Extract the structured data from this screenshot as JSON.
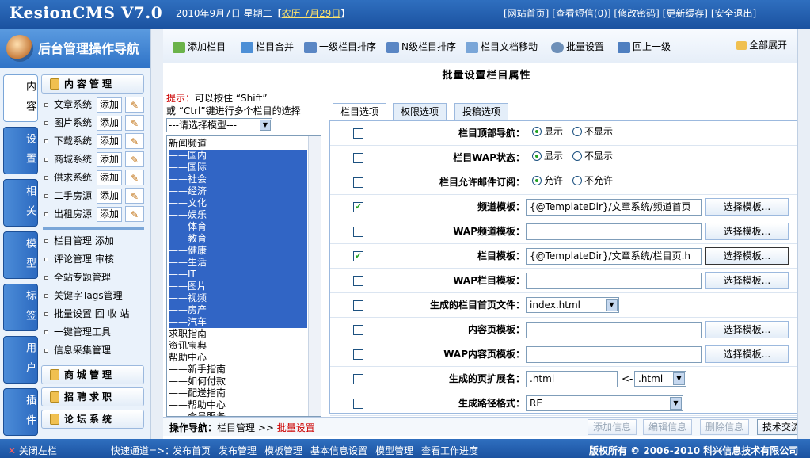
{
  "header": {
    "logo": "KesionCMS V7.0",
    "date": "2010年9月7日 星期二【",
    "lunar": "农历 7月29日",
    "date_end": "】",
    "links": [
      "[网站首页]",
      "[查看短信(0)]",
      "[修改密码]",
      "[更新缓存]",
      "[安全退出]"
    ]
  },
  "leftnav": {
    "title": "后台管理操作导航",
    "vtabs": [
      "内容",
      "设置",
      "相关",
      "模型",
      "标签",
      "用户",
      "插件"
    ],
    "content_header": "内容管理",
    "systems": [
      {
        "label": "文章系统",
        "add": "添加"
      },
      {
        "label": "图片系统",
        "add": "添加"
      },
      {
        "label": "下载系统",
        "add": "添加"
      },
      {
        "label": "商城系统",
        "add": "添加"
      },
      {
        "label": "供求系统",
        "add": "添加"
      },
      {
        "label": "二手房源",
        "add": "添加"
      },
      {
        "label": "出租房源",
        "add": "添加"
      }
    ],
    "menu": [
      "栏目管理 添加",
      "评论管理 审核",
      "全站专题管理",
      "关键字Tags管理",
      "批量设置 回 收 站",
      "一键管理工具",
      "信息采集管理"
    ],
    "panels": [
      "商城管理",
      "招聘求职",
      "论坛系统"
    ]
  },
  "toolbar": [
    "添加栏目",
    "栏目合并",
    "一级栏目排序",
    "N级栏目排序",
    "栏目文档移动",
    "批量设置",
    "回上一级"
  ],
  "expand_all": "全部展开",
  "page_title": "批量设置栏目属性",
  "hint": {
    "prefix": "提示：",
    "line1": "可以按住 “Shift”",
    "line2": "或 “Ctrl”键进行多个栏目的选择"
  },
  "model_select": "---请选择模型---",
  "categories": [
    {
      "label": "新闻频道",
      "sel": false
    },
    {
      "label": "——国内",
      "sel": true
    },
    {
      "label": "——国际",
      "sel": true
    },
    {
      "label": "——社会",
      "sel": true
    },
    {
      "label": "——经济",
      "sel": true
    },
    {
      "label": "——文化",
      "sel": true
    },
    {
      "label": "——娱乐",
      "sel": true
    },
    {
      "label": "——体育",
      "sel": true
    },
    {
      "label": "——教育",
      "sel": true
    },
    {
      "label": "——健康",
      "sel": true
    },
    {
      "label": "——生活",
      "sel": true
    },
    {
      "label": "——IT",
      "sel": true
    },
    {
      "label": "——图片",
      "sel": true
    },
    {
      "label": "——视频",
      "sel": true
    },
    {
      "label": "——房产",
      "sel": true
    },
    {
      "label": "——汽车",
      "sel": true
    },
    {
      "label": "求职指南",
      "sel": false
    },
    {
      "label": "资讯宝典",
      "sel": false
    },
    {
      "label": "帮助中心",
      "sel": false
    },
    {
      "label": "——新手指南",
      "sel": false
    },
    {
      "label": "——如何付款",
      "sel": false
    },
    {
      "label": "——配送指南",
      "sel": false
    },
    {
      "label": "——帮助中心",
      "sel": false
    },
    {
      "label": "——会员服务",
      "sel": false
    }
  ],
  "tabs": [
    "栏目选项",
    "权限选项",
    "投稿选项"
  ],
  "form": [
    {
      "label": "栏目顶部导航：",
      "type": "radio",
      "checked": false,
      "options": [
        "显示",
        "不显示"
      ]
    },
    {
      "label": "栏目WAP状态：",
      "type": "radio",
      "checked": false,
      "options": [
        "显示",
        "不显示"
      ]
    },
    {
      "label": "栏目允许邮件订阅：",
      "type": "radio",
      "checked": false,
      "options": [
        "允许",
        "不允许"
      ]
    },
    {
      "label": "频道模板：",
      "type": "tpl",
      "checked": true,
      "value": "{@TemplateDir}/文章系统/频道首页",
      "btn": "选择模板..."
    },
    {
      "label": "WAP频道模板：",
      "type": "tpl",
      "checked": false,
      "value": "",
      "btn": "选择模板..."
    },
    {
      "label": "栏目模板：",
      "type": "tpl",
      "checked": true,
      "value": "{@TemplateDir}/文章系统/栏目页.h",
      "btn": "选择模板..."
    },
    {
      "label": "WAP栏目模板：",
      "type": "tpl",
      "checked": false,
      "value": "",
      "btn": "选择模板..."
    },
    {
      "label": "生成的栏目首页文件：",
      "type": "select",
      "checked": false,
      "value": "index.html"
    },
    {
      "label": "内容页模板：",
      "type": "tpl",
      "checked": false,
      "value": "",
      "btn": "选择模板..."
    },
    {
      "label": "WAP内容页模板：",
      "type": "tpl",
      "checked": false,
      "value": "",
      "btn": "选择模板..."
    },
    {
      "label": "生成的页扩展名：",
      "type": "ext",
      "checked": false,
      "value": ".html",
      "arrow": "<-",
      "select": ".html"
    },
    {
      "label": "生成路径格式：",
      "type": "select_wide",
      "checked": false,
      "value": "RE"
    }
  ],
  "footer": {
    "nav_label": "操作导航：",
    "crumb1": "栏目管理",
    "sep": ">>",
    "crumb2": "批量设置",
    "buttons": [
      "添加信息",
      "编辑信息",
      "删除信息",
      "技术交流"
    ]
  },
  "statusbar": {
    "close": "关闭左栏",
    "quick": "快速通道=>：",
    "links": [
      "发布首页",
      "发布管理",
      "模板管理",
      "基本信息设置",
      "模型管理",
      "查看工作进度"
    ],
    "copyright": "版权所有 © 2006-2010 科兴信息技术有限公司"
  }
}
